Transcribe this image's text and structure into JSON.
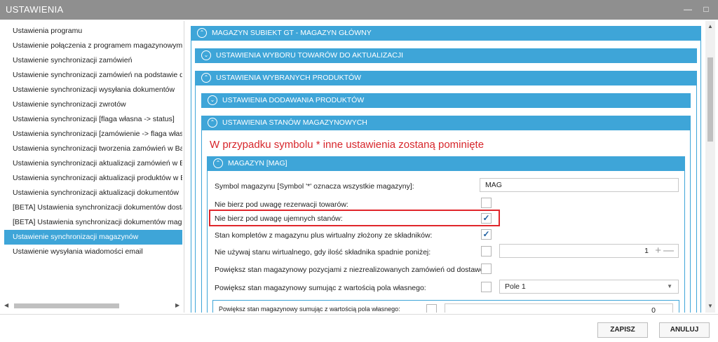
{
  "window": {
    "title": "USTAWIENIA",
    "minimize_icon": "minimize-icon",
    "maximize_icon": "maximize-icon"
  },
  "sidebar": {
    "items": [
      {
        "label": "Ustawienia programu"
      },
      {
        "label": "Ustawienie połączenia z programem magazynowym"
      },
      {
        "label": "Ustawienie synchronizacji zamówień"
      },
      {
        "label": "Ustawienie synchronizacji zamówień na podstawie dzi"
      },
      {
        "label": "Ustawienie synchronizacji wysyłania dokumentów"
      },
      {
        "label": "Ustawienie synchronizacji zwrotów"
      },
      {
        "label": "Ustawienia synchronizacji [flaga własna -> status]"
      },
      {
        "label": "Ustawienia synchronizacji [zamówienie -> flaga własn"
      },
      {
        "label": "Ustawienia synchronizacji tworzenia zamówień w Base"
      },
      {
        "label": "Ustawienia synchronizacji aktualizacji zamówień w Bas"
      },
      {
        "label": "Ustawienia synchronizacji aktualizacji produktów w Ba"
      },
      {
        "label": "Ustawienia synchronizacji aktualizacji dokumentów"
      },
      {
        "label": "[BETA] Ustawienia synchronizacji dokumentów dostaw"
      },
      {
        "label": "[BETA] Ustawienia synchronizacji dokumentów magaz"
      },
      {
        "label": "Ustawienie synchronizacji magazynów"
      },
      {
        "label": "Ustawienie wysyłania wiadomości email"
      }
    ],
    "active_index": 14
  },
  "sections": {
    "warehouse_main": "MAGAZYN SUBIEKT GT - MAGAZYN GŁÓWNY",
    "product_selection": "USTAWIENIA WYBORU TOWARÓW DO AKTUALIZACJI",
    "selected_products": "USTAWIENIA WYBRANYCH PRODUKTÓW",
    "adding_products": "USTAWIENIA DODAWANIA PRODUKTÓW",
    "stock_levels": "USTAWIENIA STANÓW MAGAZYNOWYCH",
    "warehouse_mag": "MAGAZYN [MAG]"
  },
  "warning": "W przypadku symbolu * inne ustawienia zostaną pominięte",
  "form": {
    "symbol_label": "Symbol magazynu [Symbol '*' oznacza wszystkie magazyny]:",
    "symbol_value": "MAG",
    "ignore_reservation_label": "Nie bierz pod uwagę rezerwacji towarów:",
    "ignore_reservation_checked": false,
    "ignore_negative_label": "Nie bierz pod uwagę ujemnych stanów:",
    "ignore_negative_checked": true,
    "kit_stock_label": "Stan kompletów z magazynu plus wirtualny złożony ze składników:",
    "kit_stock_checked": true,
    "virtual_stock_label": "Nie używaj stanu wirtualnego, gdy ilość składnika spadnie poniżej:",
    "virtual_stock_checked": false,
    "virtual_stock_value": "1",
    "increase_unrealized_label": "Powiększ stan magazynowy pozycjami z niezrealizowanych zamówień od dostawcy:",
    "increase_unrealized_checked": false,
    "increase_field_label": "Powiększ stan magazynowy sumując z wartością pola własnego:",
    "increase_field_checked": false,
    "increase_field_select": "Pole 1",
    "partial_row_label": "Powiększ stan magazynowy sumując z wartością pola własnego:",
    "partial_row_value": "0"
  },
  "footer": {
    "save_label": "ZAPISZ",
    "cancel_label": "ANULUJ"
  },
  "colors": {
    "accent": "#3ea5d8",
    "titlebar": "#8f8f8f",
    "warning": "#d7262b",
    "highlight": "#e0262b"
  }
}
